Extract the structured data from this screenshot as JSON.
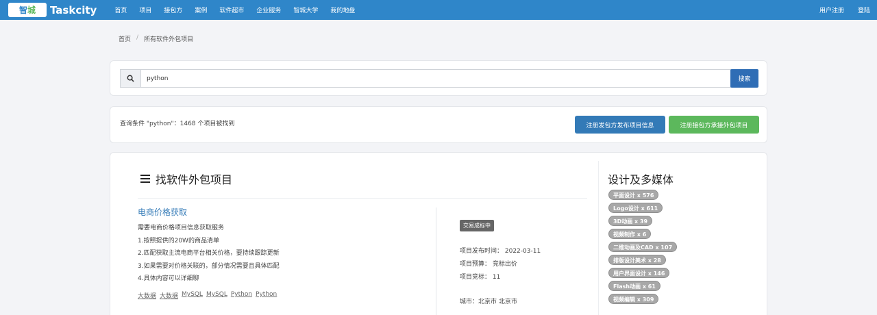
{
  "brand": {
    "badge_a": "智",
    "badge_b": "城",
    "name": "Taskcity"
  },
  "nav": {
    "items": [
      "首页",
      "项目",
      "接包方",
      "案例",
      "软件超市",
      "企业服务",
      "智城大学",
      "我的地盘"
    ],
    "right": [
      "用户注册",
      "登陆"
    ]
  },
  "breadcrumb": {
    "home": "首页",
    "sep": "/",
    "current": "所有软件外包项目"
  },
  "search": {
    "value": "python",
    "button": "搜索"
  },
  "result": {
    "text": "查询条件 \"python\"：1468 个项目被找到",
    "btn_publish": "注册发包方发布项目信息",
    "btn_join": "注册接包方承接外包项目"
  },
  "main": {
    "section_title": "找软件外包项目",
    "project": {
      "title": "电商价格获取",
      "lines": [
        "需要电商价格项目信息获取服务",
        "1.按照提供的20W的商品清单",
        "2.匹配获取主流电商平台相关价格，要持续跟踪更新",
        "3.如果需要对价格关联的，部分情况需要且具体匹配",
        "4.具体内容可以详细聊"
      ],
      "tags": [
        "大数据",
        "大数据",
        "MySQL",
        "MySQL",
        "Python",
        "Python"
      ],
      "status": "交易成标中",
      "published": "项目发布时间：  2022-03-11",
      "budget": "项目预算：  竞标出价",
      "bids": "项目竞标：  11",
      "city": "城市：北京市 北京市"
    }
  },
  "category": {
    "title": "设计及多媒体",
    "pills": [
      "平面设计 x 576",
      "Logo设计 x 611",
      "3D动画 x 39",
      "视频制作 x 6",
      "二维动画及CAD x 107",
      "排版设计美术 x 28",
      "用户界面设计 x 146",
      "Flash动画 x 61",
      "视频编辑 x 309"
    ]
  }
}
